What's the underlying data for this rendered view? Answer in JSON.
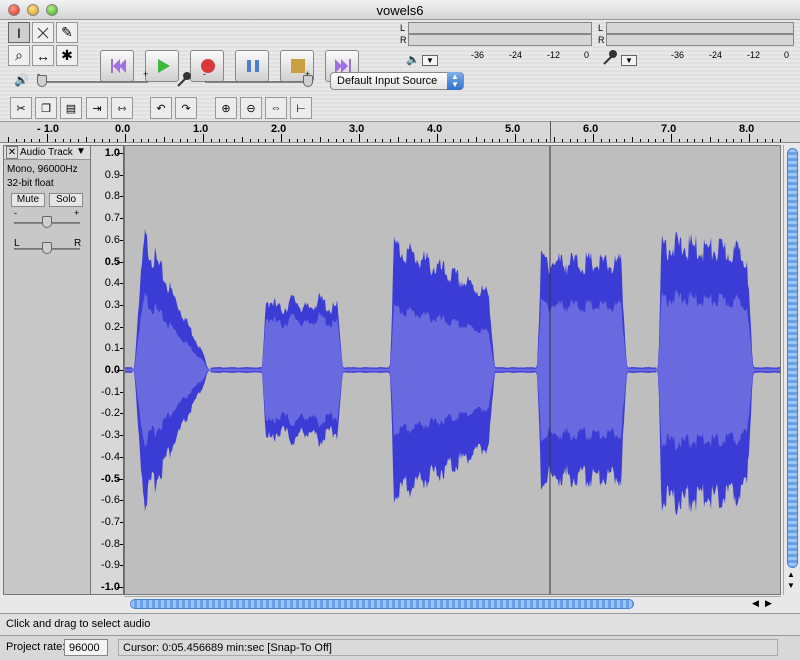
{
  "window": {
    "title": "vowels6"
  },
  "tools": {
    "selection": "I",
    "draw": "✎",
    "zoom": "⌕",
    "timeshift": "↔",
    "multi": "✱"
  },
  "meters": {
    "left_label": "L",
    "right_label": "R",
    "scale": [
      "-36",
      "-24",
      "-12",
      "0"
    ]
  },
  "mixer": {
    "slider_min": "-",
    "slider_max": "+",
    "input_source": "Default Input Source"
  },
  "ruler": {
    "labels": [
      "- 1.0",
      "0.0",
      "1.0",
      "2.0",
      "3.0",
      "4.0",
      "5.0",
      "6.0",
      "7.0",
      "8.0"
    ]
  },
  "track": {
    "name": "Audio Track",
    "format": "Mono, 96000Hz",
    "bitdepth": "32-bit float",
    "mute": "Mute",
    "solo": "Solo",
    "gain_min": "-",
    "gain_max": "+",
    "pan_left": "L",
    "pan_right": "R",
    "close": "✕"
  },
  "vruler": {
    "labels": [
      "1.0",
      "0.9",
      "0.8",
      "0.7",
      "0.6",
      "0.5",
      "0.4",
      "0.3",
      "0.2",
      "0.1",
      "0.0",
      "-0.1",
      "-0.2",
      "-0.3",
      "-0.4",
      "-0.5",
      "-0.6",
      "-0.7",
      "-0.8",
      "-0.9",
      "-1.0"
    ]
  },
  "status": {
    "hint": "Click and drag to select audio",
    "project_rate_label": "Project rate:",
    "project_rate": "96000",
    "cursor": "Cursor: 0:05.456689 min:sec   [Snap-To Off]"
  },
  "colors": {
    "wave_outer": "#3b3bd6",
    "wave_inner": "#6a6ae0",
    "wave_bg": "#bebebe"
  }
}
